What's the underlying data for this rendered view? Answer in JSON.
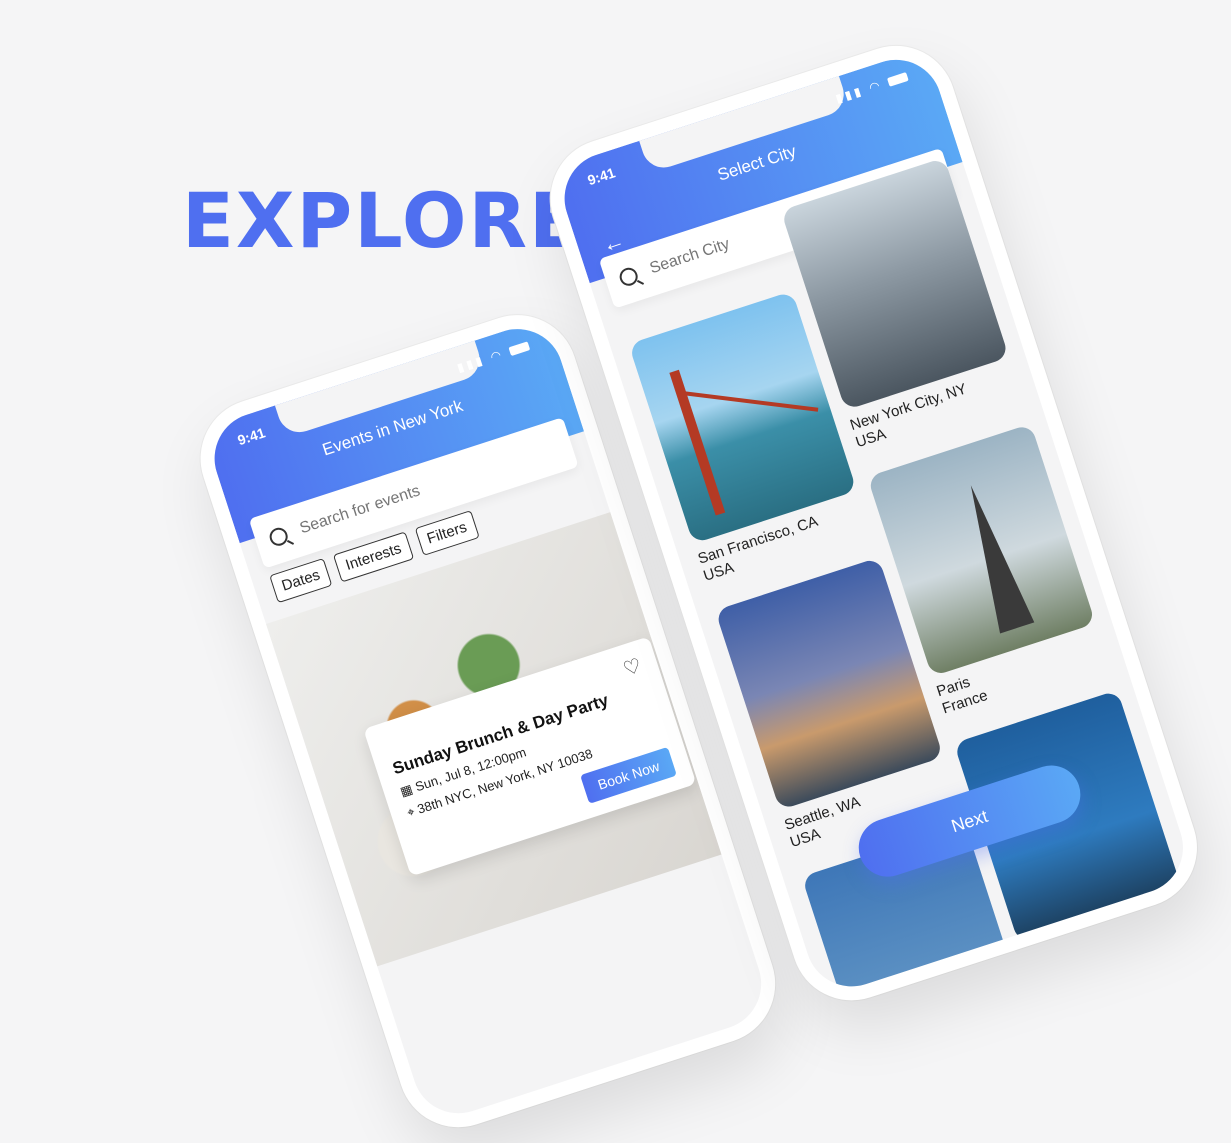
{
  "hero": {
    "title": "EXPLORE"
  },
  "events_screen": {
    "status_time": "9:41",
    "title": "Events in New York",
    "search_placeholder": "Search for events",
    "filters": [
      "Dates",
      "Interests",
      "Filters"
    ],
    "event": {
      "title": "Sunday Brunch & Day Party",
      "datetime": "Sun, Jul 8, 12:00pm",
      "location": "38th NYC, New York, NY 10038",
      "book_label": "Book Now"
    }
  },
  "city_screen": {
    "status_time": "9:41",
    "title": "Select City",
    "search_placeholder": "Search City",
    "cities": [
      {
        "name": "San Francisco, CA",
        "country": "USA"
      },
      {
        "name": "New York City, NY",
        "country": "USA"
      },
      {
        "name": "Seattle, WA",
        "country": "USA"
      },
      {
        "name": "Paris",
        "country": "France"
      }
    ],
    "next_label": "Next"
  },
  "colors": {
    "accent": "#4f6ff0",
    "accent_light": "#5aa8f5"
  }
}
